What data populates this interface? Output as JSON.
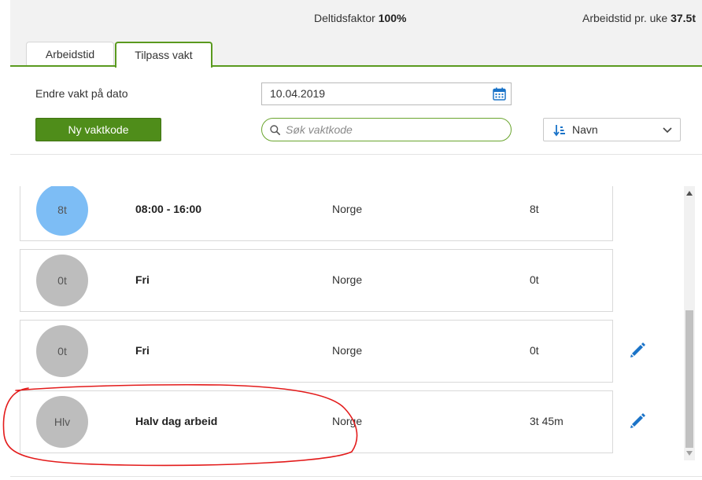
{
  "header": {
    "factor_label": "Deltidsfaktor",
    "factor_value": "100%",
    "hours_label": "Arbeidstid pr. uke",
    "hours_value": "37.5t"
  },
  "tabs": [
    {
      "label": "Arbeidstid",
      "active": false
    },
    {
      "label": "Tilpass vakt",
      "active": true
    }
  ],
  "form": {
    "date_label": "Endre vakt på dato",
    "date_value": "10.04.2019",
    "new_button": "Ny vaktkode",
    "search_placeholder": "Søk vaktkode",
    "sort_value": "Navn"
  },
  "rows": [
    {
      "avatar": "8t",
      "name": "08:00 - 16:00",
      "region": "Norge",
      "hours": "8t"
    },
    {
      "avatar": "0t",
      "name": "Fri",
      "region": "Norge",
      "hours": "0t"
    },
    {
      "avatar": "0t",
      "name": "Fri",
      "region": "Norge",
      "hours": "0t"
    },
    {
      "avatar": "Hlv",
      "name": "Halv dag arbeid",
      "region": "Norge",
      "hours": "3t 45m"
    }
  ],
  "colors": {
    "accent": "#5a9a1f",
    "button": "#4f8d1a",
    "avatar_blue": "#7dbdf5",
    "avatar_grey": "#bdbdbd",
    "edit_icon": "#1a73c8",
    "annotation": "#e31b1b"
  },
  "icons": [
    "calendar-icon",
    "search-icon",
    "sort-icon",
    "chevron-down-icon",
    "pencil-icon"
  ]
}
